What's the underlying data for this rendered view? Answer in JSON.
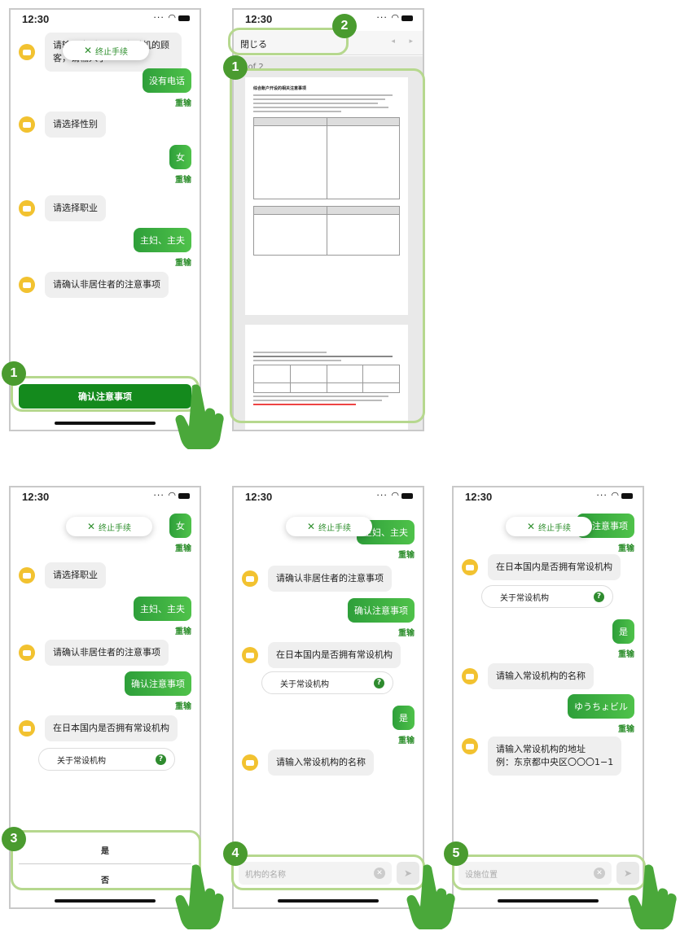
{
  "status_time": "12:30",
  "stop_label": "终止手续",
  "redo_label": "重输",
  "screen1": {
    "bot_phone": "请输入电话号码。有手机的顾客，请输入手",
    "user_no_phone": "没有电话",
    "bot_gender": "请选择性别",
    "user_female": "女",
    "bot_occupation": "请选择职业",
    "user_housewife": "主妇、主夫",
    "bot_confirm": "请确认非居住者的注意事项",
    "confirm_button": "确认注意事项",
    "step": "1"
  },
  "screen2": {
    "close_label": "閉じる",
    "page_indicator": "1 of 2",
    "doc_title": "综合账户开设的相关注意事项",
    "step_a": "2",
    "step_b": "1"
  },
  "screen3": {
    "user_female": "女",
    "bot_occupation": "请选择职业",
    "user_housewife": "主妇、主夫",
    "bot_confirm": "请确认非居住者的注意事项",
    "user_confirm": "确认注意事项",
    "bot_office": "在日本国内是否拥有常设机构",
    "about_office": "关于常设机构",
    "choice_yes": "是",
    "choice_no": "否",
    "step": "3"
  },
  "screen4": {
    "user_housewife": "主妇、主夫",
    "bot_confirm": "请确认非居住者的注意事项",
    "user_confirm": "确认注意事项",
    "bot_office": "在日本国内是否拥有常设机构",
    "about_office": "关于常设机构",
    "user_yes": "是",
    "bot_name": "请输入常设机构的名称",
    "input_placeholder": "机构的名称",
    "step": "4"
  },
  "screen5": {
    "user_confirm": "认注意事项",
    "bot_office": "在日本国内是否拥有常设机构",
    "about_office": "关于常设机构",
    "user_yes": "是",
    "bot_name": "请输入常设机构的名称",
    "user_name": "ゆうちょビル",
    "bot_address_l1": "请输入常设机构的地址",
    "bot_address_l2": "例：东京都中央区〇〇〇1−1",
    "input_placeholder": "设施位置",
    "step": "5"
  }
}
